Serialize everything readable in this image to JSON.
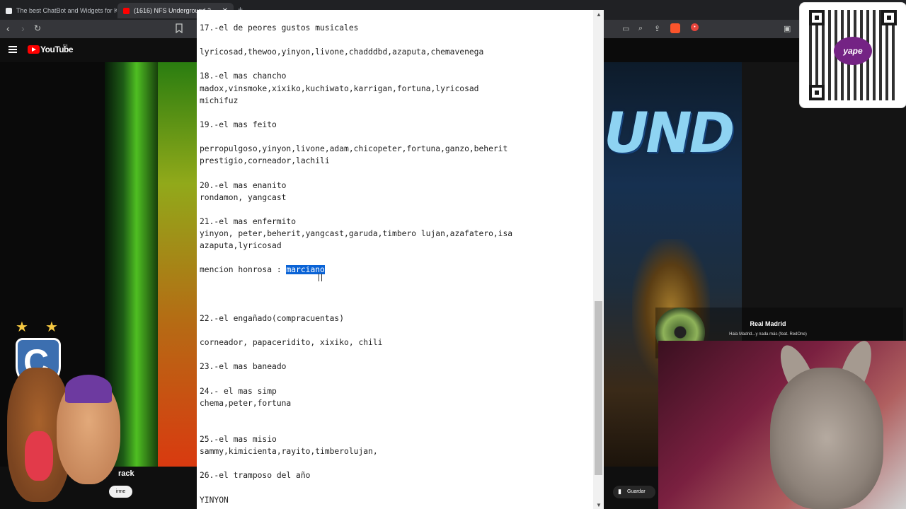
{
  "browser": {
    "tabs": [
      {
        "title": "The best ChatBot and Widgets for Ki",
        "color": "#e8eaed"
      },
      {
        "title": "(1616) NFS Underground 2 -",
        "color": "#ff0000"
      }
    ],
    "new_tab": "+"
  },
  "youtube": {
    "logo_text": "YouTube",
    "logo_suffix": "PE",
    "track_partial": "rack",
    "button_partial": "irme"
  },
  "document": {
    "lines": [
      "17.-el de peores gustos musicales",
      "",
      "lyricosad,thewoo,yinyon,livone,chadddbd,azaputa,chemavenega",
      "",
      "18.-el mas chancho",
      "madox,vinsmoke,xixiko,kuchiwato,karrigan,fortuna,lyricosad",
      "michifuz",
      "",
      "19.-el mas feito",
      "",
      "perropulgoso,yinyon,livone,adam,chicopeter,fortuna,ganzo,beherit",
      "prestigio,corneador,lachili",
      "",
      "20.-el mas enanito",
      "rondamon, yangcast",
      "",
      "21.-el mas enfermito",
      "yinyon, peter,beherit,yangcast,garuda,timbero lujan,azafatero,isa",
      "azaputa,lyricosad",
      "",
      "mencion honrosa : ",
      "",
      "",
      "",
      "22.-el engañado(compracuentas)",
      "",
      "corneador, papaceridito, xixiko, chili",
      "",
      "23.-el mas baneado",
      "",
      "24.- el mas simp",
      "chema,peter,fortuna",
      "",
      "",
      "25.-el mas misio",
      "sammy,kimicienta,rayito,timberolujan,",
      "",
      "26.-el tramposo del año",
      "",
      "YINYON"
    ],
    "selected_word": "marciano"
  },
  "now_playing": {
    "title": "Real Madrid",
    "subtitle": "Hala Madrid...y nada más (feat. RedOne)"
  },
  "qr": {
    "brand": "yape"
  },
  "right_button": "Guardar",
  "colors": {
    "selection": "#0a63d6",
    "yt_red": "#ff0000",
    "yape_purple": "#742384"
  }
}
